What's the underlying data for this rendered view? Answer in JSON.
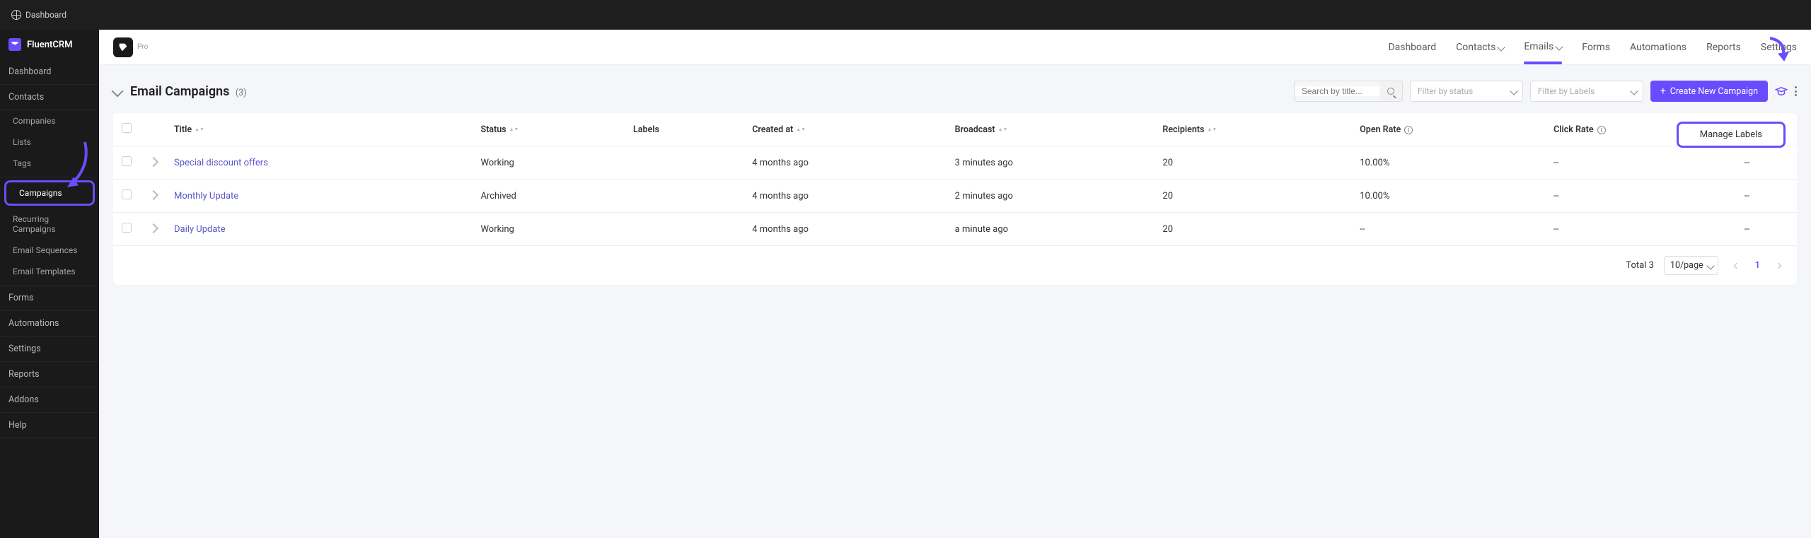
{
  "topbar": {
    "dashboard": "Dashboard"
  },
  "brand": {
    "name": "FluentCRM",
    "pro": "Pro"
  },
  "sidebar": {
    "dashboard": "Dashboard",
    "contacts": "Contacts",
    "contacts_sub": {
      "companies": "Companies",
      "lists": "Lists",
      "tags": "Tags"
    },
    "campaigns": "Campaigns",
    "campaigns_sub": {
      "recurring": "Recurring Campaigns",
      "sequences": "Email Sequences",
      "templates": "Email Templates"
    },
    "forms": "Forms",
    "automations": "Automations",
    "settings": "Settings",
    "reports": "Reports",
    "addons": "Addons",
    "help": "Help"
  },
  "topnav": {
    "dashboard": "Dashboard",
    "contacts": "Contacts",
    "emails": "Emails",
    "forms": "Forms",
    "automations": "Automations",
    "reports": "Reports",
    "settings": "Settings"
  },
  "page": {
    "title": "Email Campaigns",
    "count": "(3)"
  },
  "toolbar": {
    "search_placeholder": "Search by title...",
    "filter_status_placeholder": "Filter by status",
    "filter_labels_placeholder": "Filter by Labels",
    "create_btn": "Create New Campaign"
  },
  "columns": {
    "title": "Title",
    "status": "Status",
    "labels": "Labels",
    "created": "Created at",
    "broadcast": "Broadcast",
    "recipients": "Recipients",
    "open": "Open Rate",
    "click": "Click Rate"
  },
  "rows": [
    {
      "title": "Special discount offers",
      "status": "Working",
      "created": "4 months ago",
      "broadcast": "3 minutes ago",
      "recipients": "20",
      "open": "10.00%",
      "click": "--",
      "revenue": "--"
    },
    {
      "title": "Monthly Update",
      "status": "Archived",
      "created": "4 months ago",
      "broadcast": "2 minutes ago",
      "recipients": "20",
      "open": "10.00%",
      "click": "--",
      "revenue": "--"
    },
    {
      "title": "Daily Update",
      "status": "Working",
      "created": "4 months ago",
      "broadcast": "a minute ago",
      "recipients": "20",
      "open": "--",
      "click": "--",
      "revenue": "--"
    }
  ],
  "popover": {
    "manage_labels": "Manage Labels"
  },
  "pagination": {
    "total": "Total 3",
    "page_size": "10/page",
    "current": "1"
  }
}
